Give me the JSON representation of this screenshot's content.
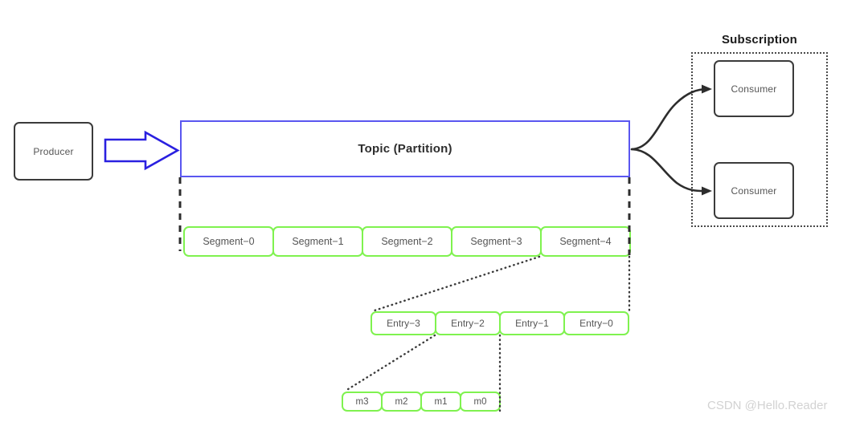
{
  "diagram": {
    "producer": {
      "label": "Producer"
    },
    "topic": {
      "label": "Topic (Partition)"
    },
    "subscription": {
      "title": "Subscription",
      "consumers": [
        {
          "label": "Consumer"
        },
        {
          "label": "Consumer"
        }
      ]
    },
    "segments": [
      {
        "label": "Segment−0"
      },
      {
        "label": "Segment−1"
      },
      {
        "label": "Segment−2"
      },
      {
        "label": "Segment−3"
      },
      {
        "label": "Segment−4"
      }
    ],
    "entries": [
      {
        "label": "Entry−3"
      },
      {
        "label": "Entry−2"
      },
      {
        "label": "Entry−1"
      },
      {
        "label": "Entry−0"
      }
    ],
    "messages": [
      {
        "label": "m3"
      },
      {
        "label": "m2"
      },
      {
        "label": "m1"
      },
      {
        "label": "m0"
      }
    ],
    "colors": {
      "topic_border": "#5a56f0",
      "arrow_blue": "#2a20e0",
      "segment_green": "#7ff24f",
      "box_dark": "#3b3b3b",
      "dotted_gray": "#4a4a4a",
      "watermark": "#d2d2d2"
    },
    "watermark": "CSDN @Hello.Reader"
  }
}
